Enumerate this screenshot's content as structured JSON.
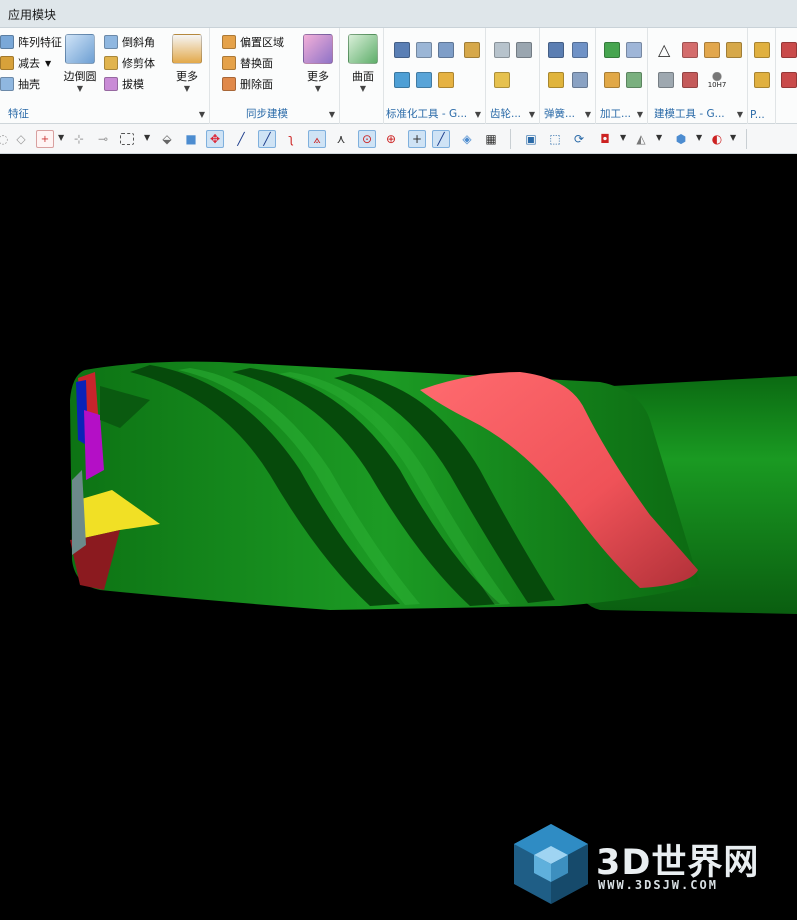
{
  "window": {
    "title": "应用模块"
  },
  "ribbon": {
    "feature_group": {
      "label": "特征",
      "items": [
        "阵列特征",
        "减去",
        "抽壳"
      ],
      "big_edge_blend": "边倒圆",
      "small_items": [
        "倒斜角",
        "修剪体",
        "拔模"
      ],
      "more": "更多"
    },
    "sync_group": {
      "label": "同步建模",
      "items": [
        "偏置区域",
        "替换面",
        "删除面"
      ],
      "more": "更多"
    },
    "surface_group": {
      "big": "曲面"
    },
    "std_tools": {
      "label": "标准化工具 - G..."
    },
    "gear": {
      "label": "齿轮..."
    },
    "spring": {
      "label": "弹簧..."
    },
    "machining": {
      "label": "加工..."
    },
    "modeling_tools": {
      "label": "建模工具 - G...",
      "tolerance_icon_text": "10H7"
    },
    "extra": {
      "label": "P..."
    }
  },
  "toolbar": {
    "selection_filter_active": true
  },
  "watermark": {
    "brand": "3D世界网",
    "url": "WWW.3DSJW.COM"
  },
  "colors": {
    "tool_body": "#0f7a16",
    "highlight_face": "#f0575c",
    "tip_yellow": "#f1e025",
    "tip_magenta": "#b40fc6",
    "tip_blue": "#0a22b8",
    "ribbon_label": "#2a6aa8"
  }
}
